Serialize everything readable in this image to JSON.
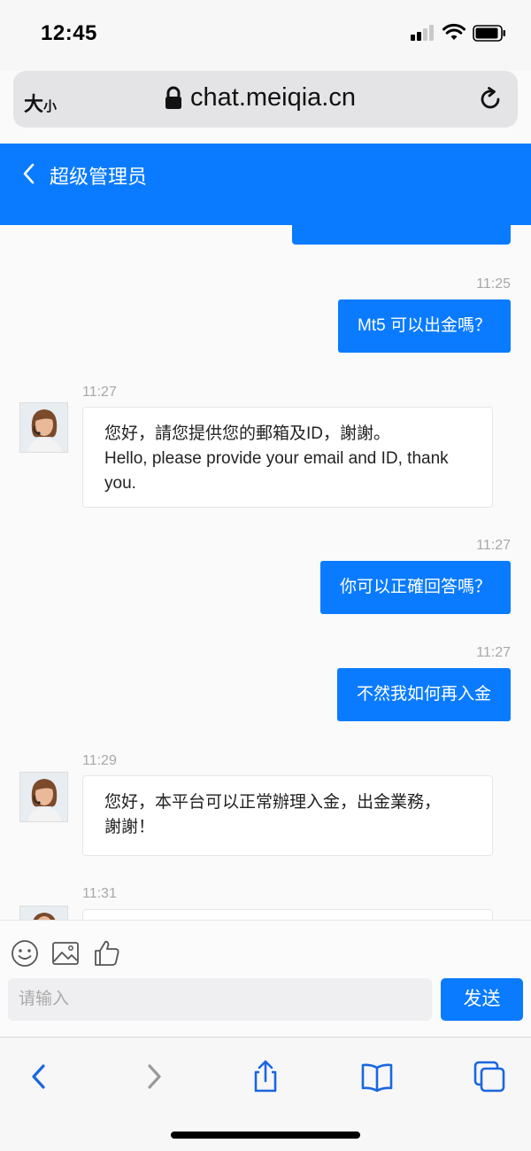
{
  "status_bar": {
    "time": "12:45"
  },
  "browser": {
    "text_size_big": "大",
    "text_size_small": "小",
    "url": "chat.meiqia.cn"
  },
  "chat": {
    "title": "超级管理员"
  },
  "messages": [
    {
      "time": "11:25",
      "text": "Mt5 可以出金嗎？"
    },
    {
      "time": "11:27",
      "line1": "您好，請您提供您的郵箱及ID，謝謝。",
      "line2": "Hello, please provide your email and ID, thank",
      "line3": "you."
    },
    {
      "time": "11:27",
      "text": "你可以正確回答嗎？"
    },
    {
      "time": "11:27",
      "text": "不然我如何再入金"
    },
    {
      "time": "11:29",
      "line1": "您好，本平台可以正常辦理入金，出金業務，",
      "line2": "謝謝！"
    },
    {
      "time": "11:31"
    }
  ],
  "input": {
    "placeholder": "请输入",
    "send_label": "发送"
  },
  "colors": {
    "accent": "#0a7bff",
    "ios_blue": "#1a66e0"
  }
}
